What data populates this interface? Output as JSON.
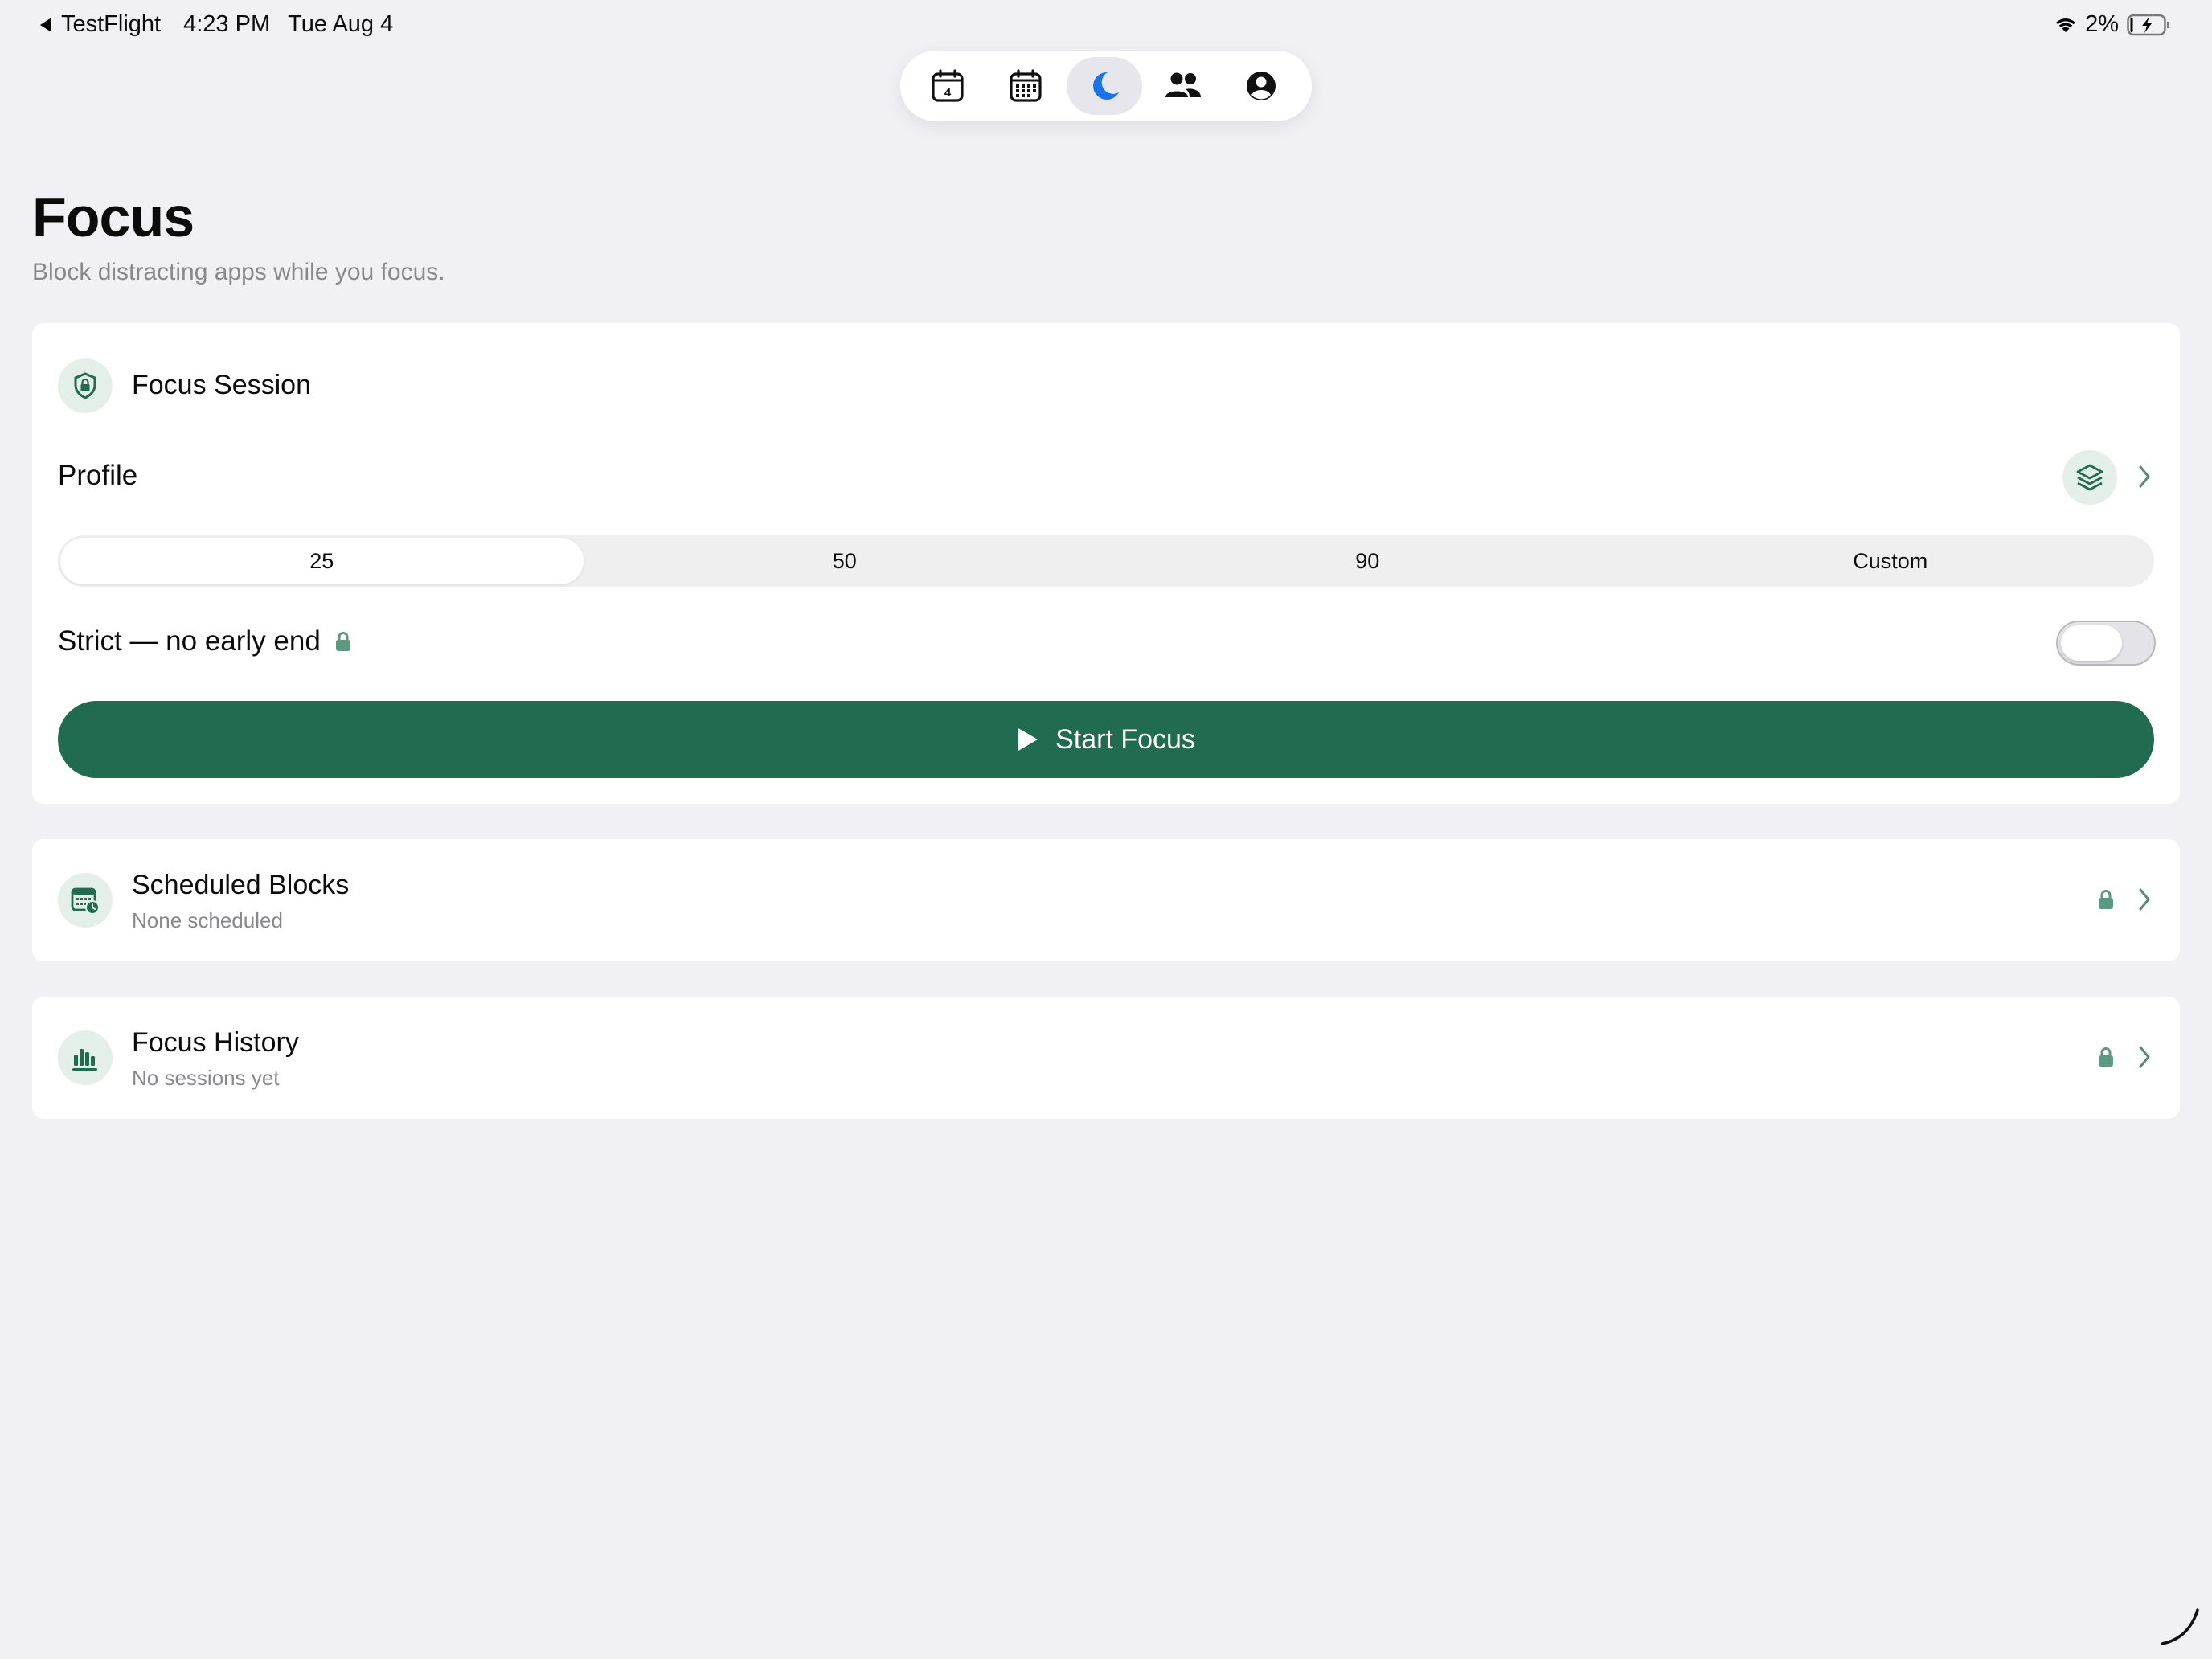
{
  "status_bar": {
    "back_app": "TestFlight",
    "time": "4:23 PM",
    "date": "Tue Aug 4",
    "battery_percent": "2%"
  },
  "tab_bar": {
    "tabs": [
      {
        "icon": "calendar-day-icon",
        "badge": "4",
        "active": false
      },
      {
        "icon": "calendar-month-icon",
        "active": false
      },
      {
        "icon": "moon-icon",
        "active": true
      },
      {
        "icon": "people-icon",
        "active": false
      },
      {
        "icon": "profile-icon",
        "active": false
      }
    ]
  },
  "header": {
    "title": "Focus",
    "subtitle": "Block distracting apps while you focus."
  },
  "focus_session": {
    "title": "Focus Session",
    "profile_label": "Profile",
    "durations": [
      "25",
      "50",
      "90",
      "Custom"
    ],
    "selected_duration": "25",
    "strict_label": "Strict — no early end",
    "strict_enabled": false,
    "start_label": "Start Focus"
  },
  "scheduled_blocks": {
    "title": "Scheduled Blocks",
    "subtitle": "None scheduled"
  },
  "focus_history": {
    "title": "Focus History",
    "subtitle": "No sessions yet"
  },
  "colors": {
    "accent": "#216b50",
    "background": "#f1f0f5",
    "active_tab_icon": "#1a73e8"
  }
}
